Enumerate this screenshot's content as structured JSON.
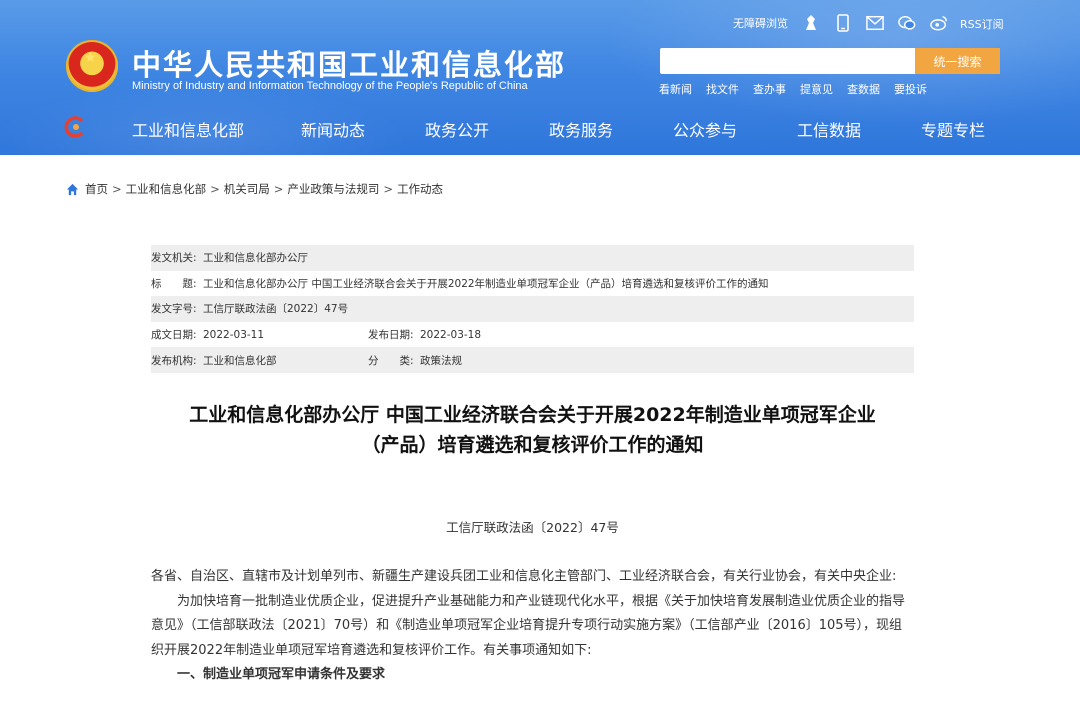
{
  "header": {
    "title": "中华人民共和国工业和信息化部",
    "subtitle": "Ministry of Industry and Information Technology of the People's Republic of China",
    "accessibility": "无障碍浏览",
    "rss": "RSS订阅",
    "search_placeholder": "",
    "search_button": "统一搜索",
    "quick_links": [
      "看新闻",
      "找文件",
      "查办事",
      "提意见",
      "查数据",
      "要投诉"
    ],
    "brand_color": "#3f86e3",
    "accent_color": "#f2a641"
  },
  "nav": [
    "工业和信息化部",
    "新闻动态",
    "政务公开",
    "政务服务",
    "公众参与",
    "工信数据",
    "专题专栏"
  ],
  "breadcrumb": [
    "首页",
    "工业和信息化部",
    "机关司局",
    "产业政策与法规司",
    "工作动态"
  ],
  "meta": {
    "issuer_label": "发文机关:",
    "issuer": "工业和信息化部办公厅",
    "subject_label": "标　　题:",
    "subject": "工业和信息化部办公厅 中国工业经济联合会关于开展2022年制造业单项冠军企业（产品）培育遴选和复核评价工作的通知",
    "docno_label": "发文字号:",
    "docno": "工信厅联政法函〔2022〕47号",
    "created_label": "成文日期:",
    "created": "2022-03-11",
    "published_label": "发布日期:",
    "published": "2022-03-18",
    "org_label": "发布机构:",
    "org": "工业和信息化部",
    "category_label": "分　　类:",
    "category": "政策法规"
  },
  "article": {
    "title_line1": "工业和信息化部办公厅 中国工业经济联合会关于开展2022年制造业单项冠军企业",
    "title_line2": "（产品）培育遴选和复核评价工作的通知",
    "docno": "工信厅联政法函〔2022〕47号",
    "salutation": "各省、自治区、直辖市及计划单列市、新疆生产建设兵团工业和信息化主管部门、工业经济联合会，有关行业协会，有关中央企业:",
    "paragraph1": "为加快培育一批制造业优质企业，促进提升产业基础能力和产业链现代化水平，根据《关于加快培育发展制造业优质企业的指导意见》（工信部联政法〔2021〕70号）和《制造业单项冠军企业培育提升专项行动实施方案》（工信部产业〔2016〕105号），现组织开展2022年制造业单项冠军培育遴选和复核评价工作。有关事项通知如下:",
    "heading1": "一、制造业单项冠军申请条件及要求"
  }
}
